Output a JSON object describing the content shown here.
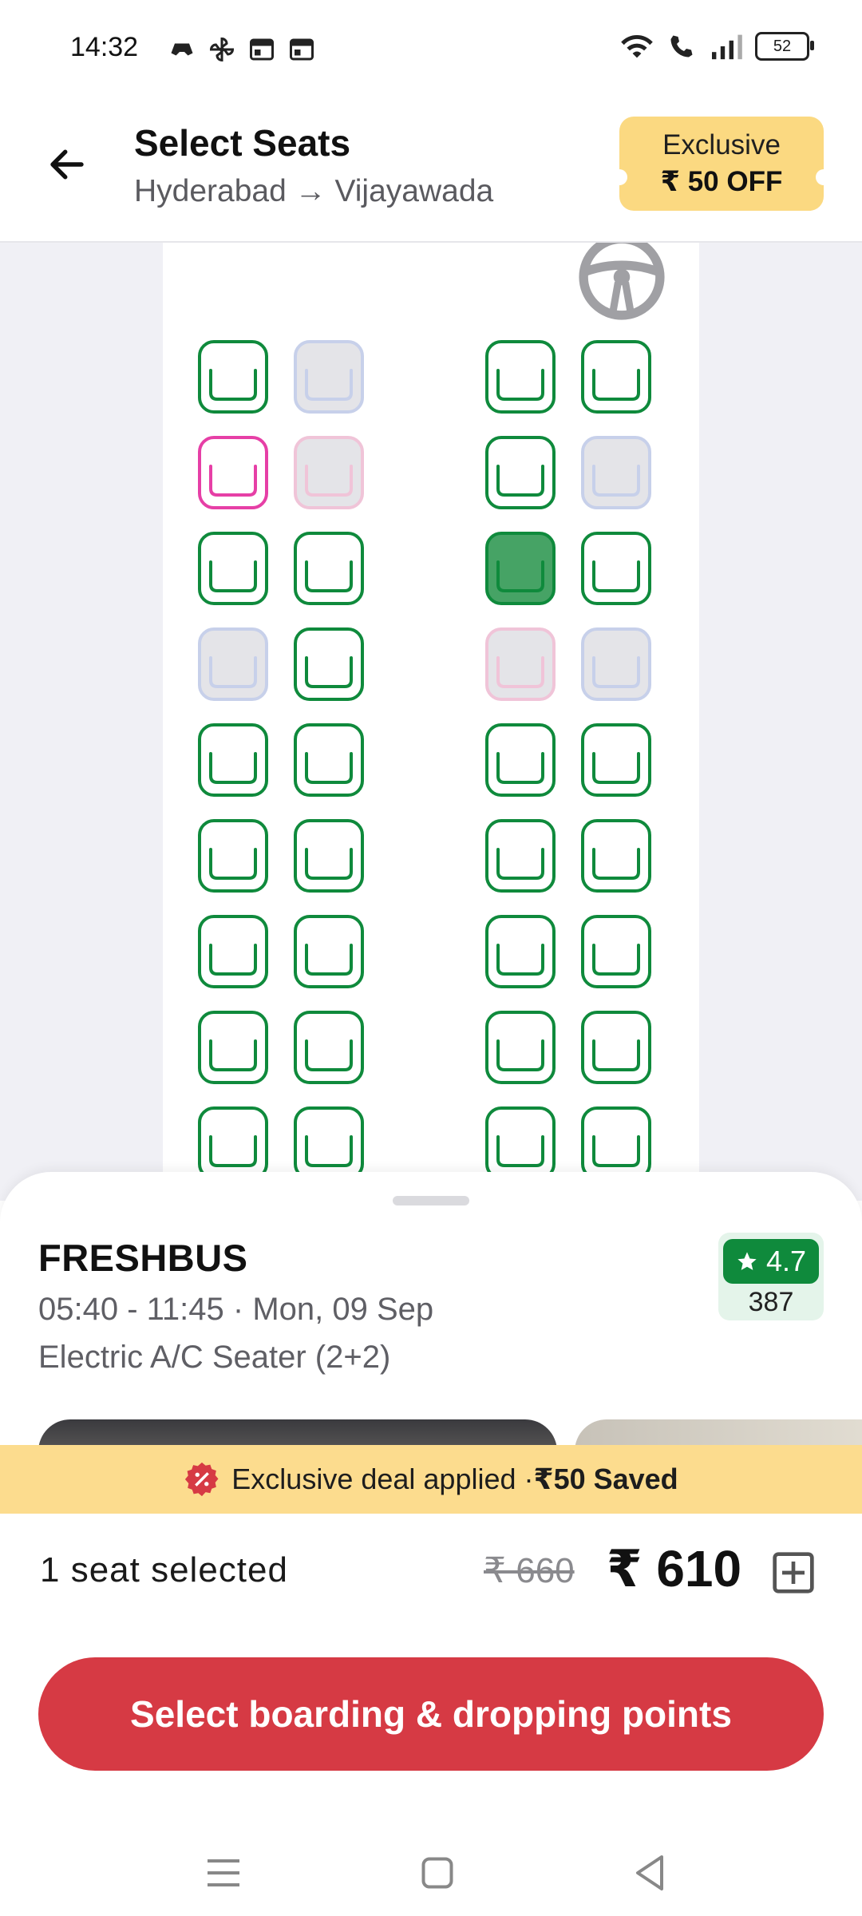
{
  "status_bar": {
    "time": "14:32",
    "battery": "52"
  },
  "header": {
    "title": "Select Seats",
    "route": "Hyderabad → Vijayawada",
    "offer_line1": "Exclusive",
    "offer_line2": "₹ 50 OFF"
  },
  "colors": {
    "available": "#0f8a3c",
    "ladies": "#e63fa6",
    "booked_fill": "#e4e4e8",
    "booked_male_border": "#c7d0ea",
    "booked_female_border": "#f0c4d8",
    "selected_fill": "#46a365",
    "cta": "#d63a44",
    "deal_bar": "#fcdc8e"
  },
  "seat_rows": [
    [
      "available",
      "booked",
      "available",
      "available"
    ],
    [
      "ladies",
      "booked-ladies",
      "available",
      "booked"
    ],
    [
      "available",
      "available",
      "selected",
      "available"
    ],
    [
      "booked",
      "available",
      "booked-ladies",
      "booked"
    ],
    [
      "available",
      "available",
      "available",
      "available"
    ],
    [
      "available",
      "available",
      "available",
      "available"
    ],
    [
      "available",
      "available",
      "available",
      "available"
    ],
    [
      "available",
      "available",
      "available",
      "available"
    ],
    [
      "available",
      "available",
      "available",
      "available"
    ]
  ],
  "bus": {
    "operator": "FRESHBUS",
    "timing": "05:40 - 11:45 · Mon, 09 Sep",
    "type": "Electric A/C Seater (2+2)",
    "rating": "4.7",
    "rating_count": "387"
  },
  "deal": {
    "text": "Exclusive deal applied · ",
    "saved": "₹50 Saved"
  },
  "selection": {
    "count_text": "1 seat selected",
    "old_price": "₹ 660",
    "new_price": "₹ 610"
  },
  "cta_label": "Select boarding & dropping points"
}
